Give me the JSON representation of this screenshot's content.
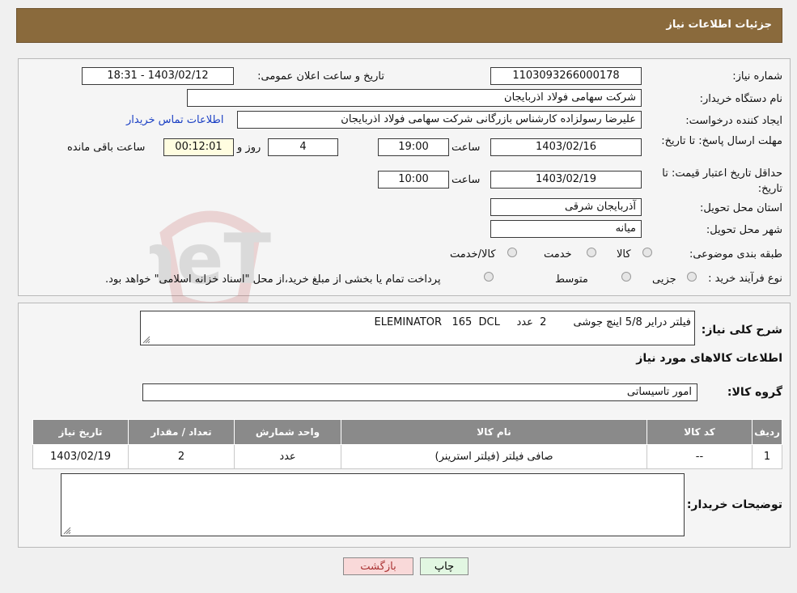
{
  "header": {
    "title": "جزئیات اطلاعات نیاز"
  },
  "details": {
    "need_number_label": "شماره نیاز:",
    "need_number": "1103093266000178",
    "announce_label": "تاریخ و ساعت اعلان عمومی:",
    "announce_value": "1403/02/12 - 18:31",
    "buyer_org_label": "نام دستگاه خریدار:",
    "buyer_org": "شرکت سهامی فولاد اذربایجان",
    "creator_label": "ایجاد کننده درخواست:",
    "creator": "علیرضا رسولزاده کارشناس بازرگانی شرکت سهامی فولاد اذربایجان",
    "contact_link": "اطلاعات تماس خریدار",
    "deadline_label": "مهلت ارسال پاسخ: تا تاریخ:",
    "deadline_date": "1403/02/16",
    "time_label": "ساعت",
    "deadline_time": "19:00",
    "days": "4",
    "days_label": "روز و",
    "remaining_time": "00:12:01",
    "remaining_label": "ساعت باقی مانده",
    "validity_label": "حداقل تاریخ اعتبار قیمت: تا تاریخ:",
    "validity_date": "1403/02/19",
    "validity_time": "10:00",
    "province_label": "استان محل تحویل:",
    "province": "آذربایجان شرقی",
    "city_label": "شهر محل تحویل:",
    "city": "میانه",
    "category_label": "طبقه بندی موضوعی:",
    "category_options": [
      "کالا",
      "خدمت",
      "کالا/خدمت"
    ],
    "process_label": "نوع فرآیند خرید :",
    "process_options": [
      "جزیی",
      "متوسط"
    ],
    "process_note": "پرداخت تمام یا بخشی از مبلغ خرید،از محل \"اسناد خزانه اسلامی\" خواهد بود."
  },
  "description": {
    "label": "شرح کلی نیاز:",
    "text": "فیلتر درایر 5/8 اینچ جوشی        2  عدد     ELEMINATOR   165  DCL"
  },
  "goods": {
    "section_title": "اطلاعات کالاهای مورد نیاز",
    "group_label": "گروه کالا:",
    "group_value": "امور تاسیساتی",
    "columns": [
      "ردیف",
      "کد کالا",
      "نام کالا",
      "واحد شمارش",
      "تعداد / مقدار",
      "تاریخ نیاز"
    ],
    "rows": [
      {
        "row": "1",
        "code": "--",
        "name": "صافی فیلتر (فیلتر استرینر)",
        "unit": "عدد",
        "qty": "2",
        "date": "1403/02/19"
      }
    ]
  },
  "buyer_notes": {
    "label": "توضیحات خریدار:",
    "text": ""
  },
  "buttons": {
    "print": "چاپ",
    "back": "بازگشت"
  },
  "watermark": {
    "text": "AriaTender.neT"
  },
  "colors": {
    "header": "#8a6a3c",
    "back_button": "#f9d9d9",
    "print_button": "#e2f7e2",
    "link": "#1a3fc4"
  }
}
